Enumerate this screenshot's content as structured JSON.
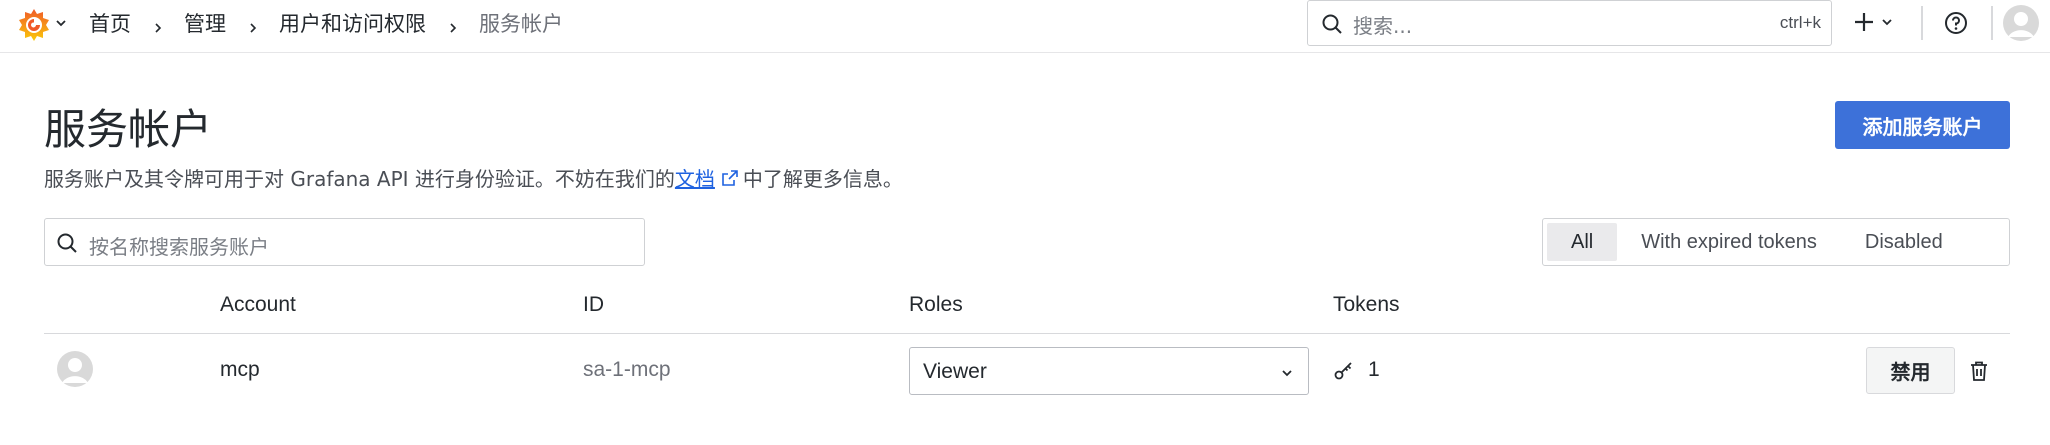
{
  "topbar": {
    "breadcrumbs": [
      "首页",
      "管理",
      "用户和访问权限",
      "服务帐户"
    ],
    "search_placeholder": "搜索...",
    "search_shortcut": "ctrl+k"
  },
  "page": {
    "title": "服务帐户",
    "description_before": "服务账户及其令牌可用于对 Grafana API 进行身份验证。不妨在我们的",
    "description_link": "文档",
    "description_after": "中了解更多信息。",
    "add_button": "添加服务账户"
  },
  "filter": {
    "search_placeholder": "按名称搜索服务账户",
    "options": [
      "All",
      "With expired tokens",
      "Disabled"
    ],
    "active": "All"
  },
  "table": {
    "columns": [
      "Account",
      "ID",
      "Roles",
      "Tokens"
    ],
    "rows": [
      {
        "account": "mcp",
        "id": "sa-1-mcp",
        "role": "Viewer",
        "tokens": "1",
        "disable_label": "禁用"
      }
    ]
  },
  "colors": {
    "primary": "#3d71d9",
    "link": "#1f62e0",
    "grafana_orange": "#f05a28",
    "grafana_yellow": "#fbca0a"
  },
  "icons": [
    "grafana-logo-icon",
    "chevron-right-icon",
    "search-icon",
    "plus-icon",
    "help-icon",
    "avatar-icon",
    "external-link-icon",
    "key-icon",
    "trash-icon",
    "chevron-down-icon"
  ]
}
